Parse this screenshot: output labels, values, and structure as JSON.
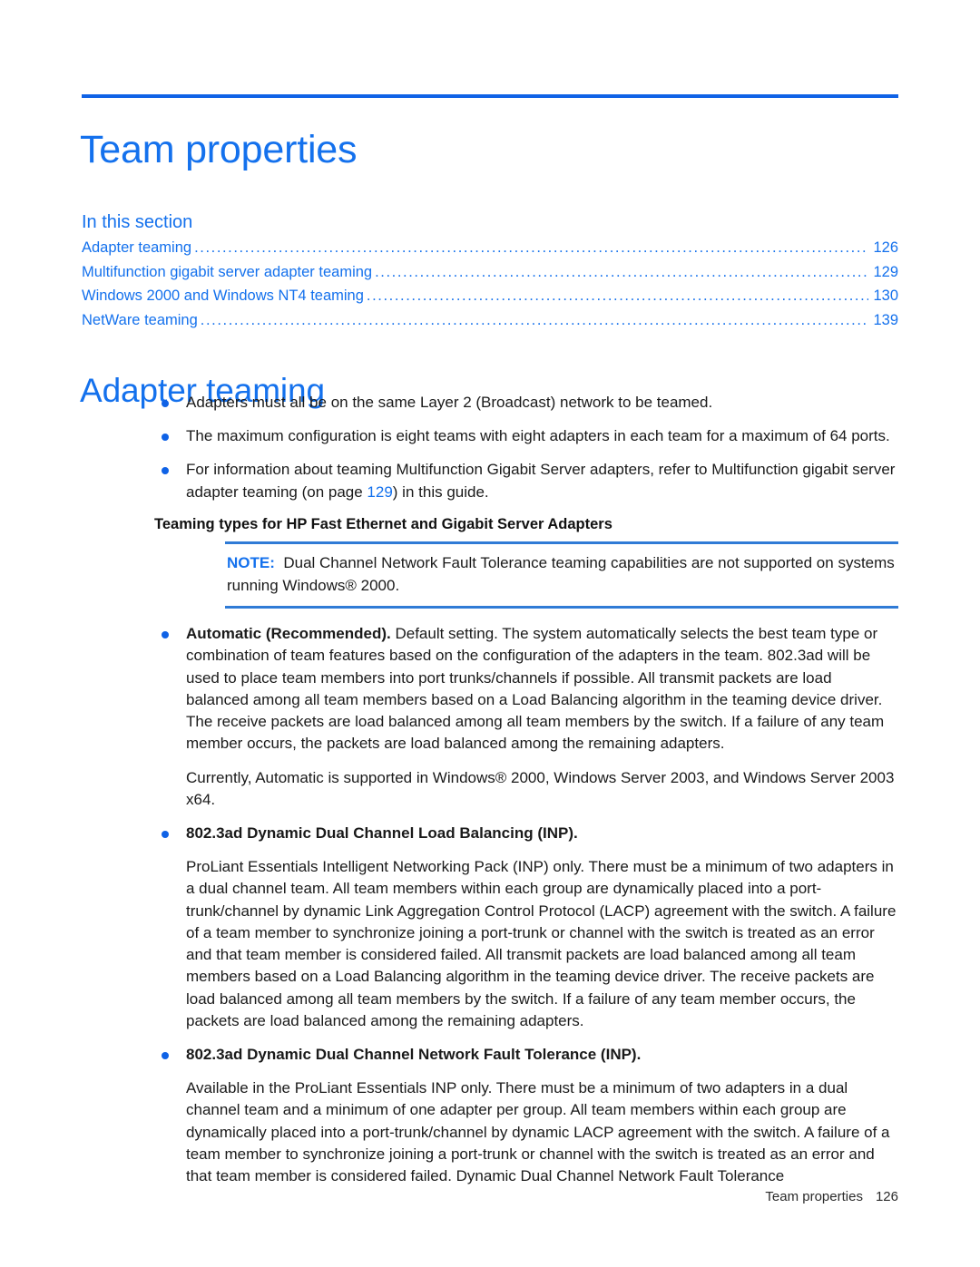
{
  "colors": {
    "accent_blue": "#1471ED",
    "rule_blue": "#0F62E6",
    "note_rule_blue": "#2F7BD6",
    "body_text": "#1a1a1a"
  },
  "chapter": {
    "title": "Team properties"
  },
  "toc": {
    "heading": "In this section",
    "entries": [
      {
        "label": "Adapter teaming",
        "page": "126"
      },
      {
        "label": "Multifunction gigabit server adapter teaming",
        "page": "129"
      },
      {
        "label": "Windows 2000 and Windows NT4 teaming",
        "page": "130"
      },
      {
        "label": "NetWare teaming",
        "page": "139"
      }
    ]
  },
  "section": {
    "heading": "Adapter teaming",
    "bullets": [
      "Adapters must all be on the same Layer 2 (Broadcast) network to be teamed.",
      "The maximum configuration is eight teams with eight adapters in each team for a maximum of 64 ports."
    ],
    "bullet_with_link": {
      "before": "For information about teaming Multifunction Gigabit Server adapters, refer to Multifunction gigabit server adapter teaming (on page ",
      "link": "129",
      "after": ") in this guide."
    }
  },
  "teaming_types": {
    "heading": "Teaming types for HP Fast Ethernet and Gigabit Server Adapters",
    "note": {
      "label": "NOTE:",
      "text": "Dual Channel Network Fault Tolerance teaming capabilities are not supported on systems running Windows® 2000."
    },
    "items": [
      {
        "bold_lead": "Automatic (Recommended).",
        "body": " Default setting. The system automatically selects the best team type or combination of team features based on the configuration of the adapters in the team. 802.3ad will be used to place team members into port trunks/channels if possible. All transmit packets are load balanced among all team members based on a Load Balancing algorithm in the teaming device driver. The receive packets are load balanced among all team members by the switch. If a failure of any team member occurs, the packets are load balanced among the remaining adapters.",
        "extra_paragraph": "Currently, Automatic is supported in Windows® 2000, Windows Server 2003, and Windows Server 2003 x64."
      },
      {
        "bold_lead": "802.3ad Dynamic Dual Channel Load Balancing (INP).",
        "body": "",
        "extra_paragraph": "ProLiant Essentials Intelligent Networking Pack (INP) only. There must be a minimum of two adapters in a dual channel team. All team members within each group are dynamically placed into a port-trunk/channel by dynamic Link Aggregation Control Protocol (LACP) agreement with the switch. A failure of a team member to synchronize joining a port-trunk or channel with the switch is treated as an error and that team member is considered failed. All transmit packets are load balanced among all team members based on a Load Balancing algorithm in the teaming device driver. The receive packets are load balanced among all team members by the switch. If a failure of any team member occurs, the packets are load balanced among the remaining adapters."
      },
      {
        "bold_lead": "802.3ad Dynamic Dual Channel Network Fault Tolerance (INP).",
        "body": "",
        "extra_paragraph": "Available in the ProLiant Essentials INP only. There must be a minimum of two adapters in a dual channel team and a minimum of one adapter per group. All team members within each group are dynamically placed into a port-trunk/channel by dynamic LACP agreement with the switch. A failure of a team member to synchronize joining a port-trunk or channel with the switch is treated as an error and that team member is considered failed. Dynamic Dual Channel Network Fault Tolerance"
      }
    ]
  },
  "footer": {
    "chapter_name": "Team properties",
    "page_number": "126"
  }
}
